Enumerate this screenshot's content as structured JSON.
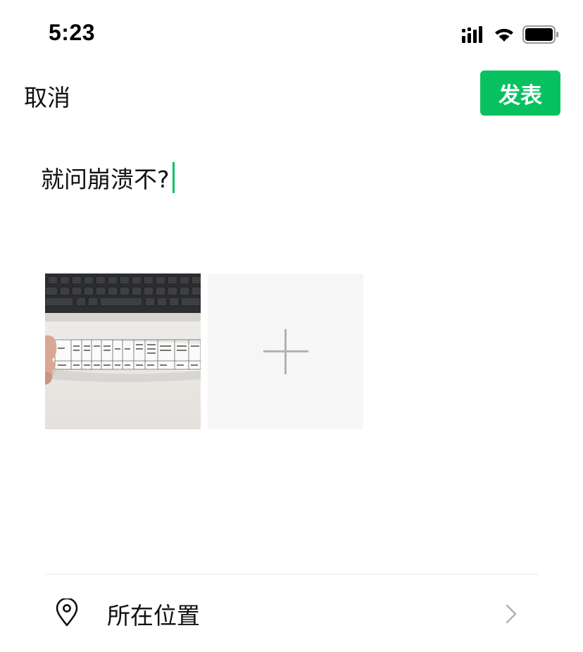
{
  "status_bar": {
    "time": "5:23",
    "icons": [
      "signal-icon",
      "wifi-icon",
      "battery-icon"
    ]
  },
  "nav": {
    "cancel_label": "取消",
    "publish_label": "发表"
  },
  "composer": {
    "text": "就问崩溃不?"
  },
  "media": {
    "items": [
      {
        "type": "photo",
        "description_icon": "photo-thumbnail"
      }
    ],
    "add_icon": "plus-icon"
  },
  "location": {
    "label": "所在位置",
    "icon": "location-pin-icon",
    "chevron": "chevron-right-icon"
  },
  "colors": {
    "accent": "#07c160",
    "text": "#111111",
    "tile_bg": "#f6f6f6",
    "divider": "#e5e5e5"
  }
}
